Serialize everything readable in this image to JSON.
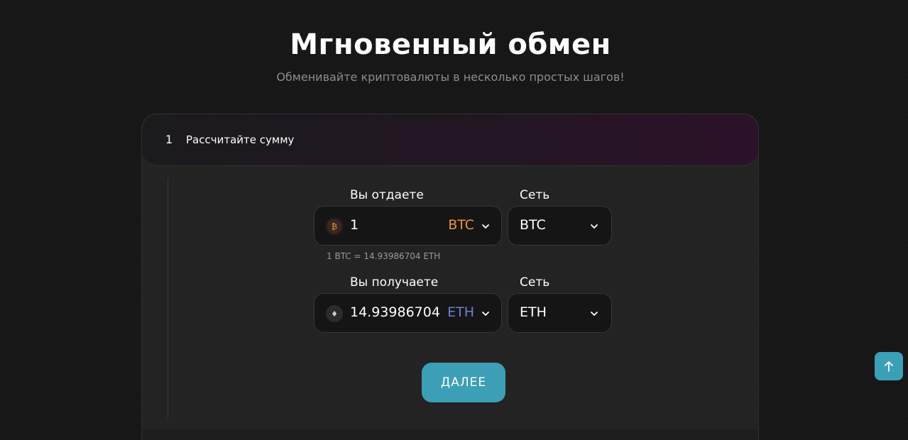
{
  "header": {
    "title": "Мгновенный обмен",
    "subtitle": "Обменивайте криптовалюты в несколько простых шагов!"
  },
  "step": {
    "number": "1",
    "label": "Рассчитайте сумму"
  },
  "give": {
    "label": "Вы отдаете",
    "amount": "1",
    "currency": "BTC",
    "icon": "bitcoin-icon",
    "network_label": "Сеть",
    "network_value": "BTC",
    "rate": "1 BTC = 14.93986704 ETH"
  },
  "receive": {
    "label": "Вы получаете",
    "amount": "14.93986704",
    "currency": "ETH",
    "icon": "ethereum-icon",
    "network_label": "Сеть",
    "network_value": "ETH"
  },
  "actions": {
    "next_label": "ДАЛЕЕ",
    "scroll_top_icon": "arrow-up-icon"
  },
  "colors": {
    "accent": "#3c9fb5",
    "btc": "#f0922c",
    "eth": "#6a7fd6",
    "background": "#161616",
    "card": "#232323"
  }
}
